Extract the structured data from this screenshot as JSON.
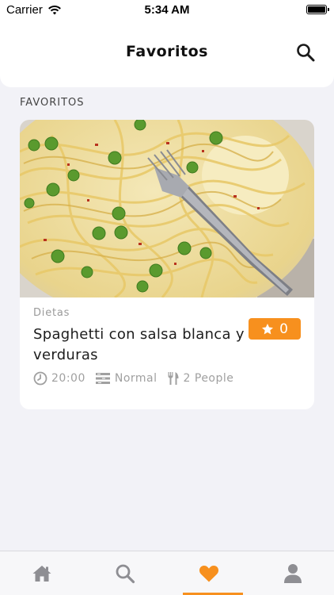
{
  "status_bar": {
    "carrier": "Carrier",
    "time": "5:34 AM"
  },
  "nav": {
    "title": "Favoritos",
    "search_icon": "search-icon"
  },
  "section": {
    "label": "FAVORITOS"
  },
  "recipe": {
    "category": "Dietas",
    "title": "Spaghetti con salsa blanca y verduras",
    "rating": "0",
    "time": "20:00",
    "difficulty": "Normal",
    "servings": "2 People"
  },
  "tab_bar": {
    "tabs": [
      {
        "icon": "home-icon",
        "active": false
      },
      {
        "icon": "search-icon",
        "active": false
      },
      {
        "icon": "heart-icon",
        "active": true
      },
      {
        "icon": "user-icon",
        "active": false
      }
    ]
  },
  "colors": {
    "accent": "#f7901e",
    "inactive_icon": "#8e8e93",
    "background": "#f2f2f7"
  }
}
